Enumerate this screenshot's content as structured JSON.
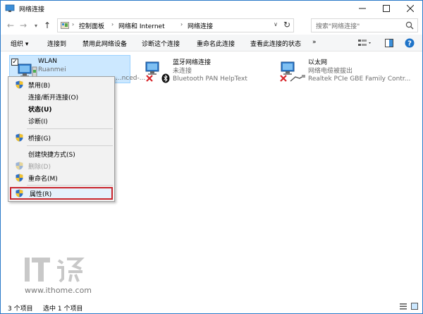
{
  "window": {
    "title": "网络连接",
    "icon": "network-connections-icon",
    "controls": [
      "minimize-icon",
      "maximize-icon",
      "close-icon"
    ]
  },
  "nav": {
    "breadcrumbs": [
      "控制面板",
      "网络和 Internet",
      "网络连接"
    ],
    "search_placeholder": "搜索\"网络连接\""
  },
  "command_bar": {
    "items": [
      "组织 ▾",
      "连接到",
      "禁用此网络设备",
      "诊断这个连接",
      "重命名此连接",
      "查看此连接的状态",
      "»"
    ]
  },
  "adapters": [
    {
      "name": "WLAN",
      "status": "Ruanmei",
      "device": "...nced-...",
      "selected": true,
      "checked": true
    },
    {
      "name": "蓝牙网络连接",
      "status": "未连接",
      "device": "Bluetooth PAN HelpText",
      "error": true
    },
    {
      "name": "以太网",
      "status": "网络电缆被拔出",
      "device": "Realtek PCIe GBE Family Contr...",
      "error": true
    }
  ],
  "context_menu": {
    "items": [
      {
        "label": "禁用(B)",
        "shield": true
      },
      {
        "label": "连接/断开连接(O)"
      },
      {
        "label": "状态(U)",
        "bold": true
      },
      {
        "label": "诊断(I)"
      },
      {
        "label": "桥接(G)",
        "shield": true
      },
      {
        "label": "创建快捷方式(S)"
      },
      {
        "label": "删除(D)",
        "shield": true,
        "disabled": true
      },
      {
        "label": "重命名(M)",
        "shield": true
      },
      {
        "label": "属性(R)",
        "shield": true,
        "highlighted": true
      }
    ]
  },
  "watermark": {
    "url": "www.ithome.com"
  },
  "statusbar": {
    "count": "3 个项目",
    "selected": "选中 1 个项目"
  },
  "colors": {
    "accent": "#2b7ac9",
    "selection": "#cce8ff",
    "highlight_border": "#c9252c",
    "error_red": "#d8262b"
  }
}
